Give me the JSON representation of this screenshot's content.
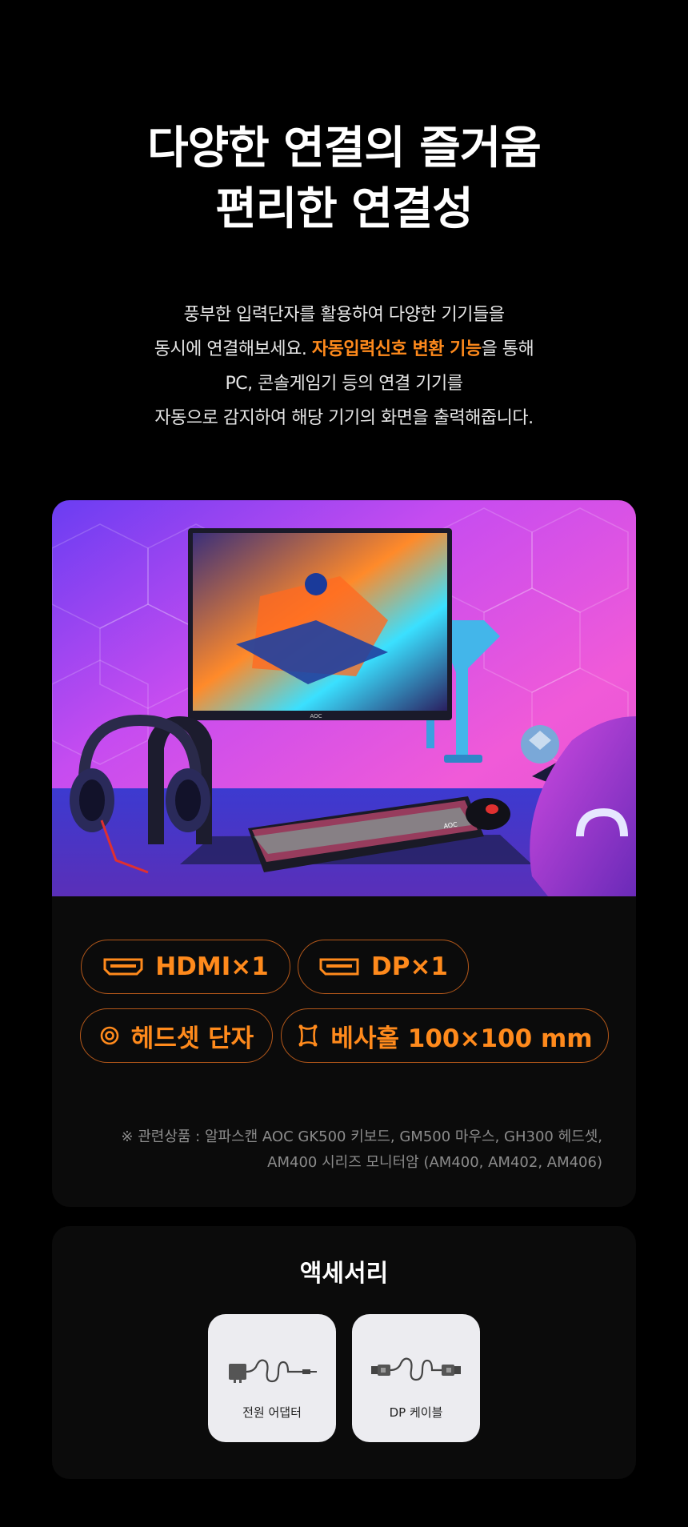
{
  "headline": {
    "line1": "다양한 연결의 즐거움",
    "line2": "편리한 연결성"
  },
  "description": {
    "line1": "풍부한 입력단자를 활용하여 다양한 기기들을",
    "line2_pre": "동시에 연결해보세요. ",
    "line2_highlight": "자동입력신호 변환 기능",
    "line2_post": "을 통해",
    "line3": "PC, 콘솔게임기 등의 연결 기기를",
    "line4": "자동으로 감지하여 해당 기기의 화면을 출력해줍니다."
  },
  "colors": {
    "accent": "#ff8a1c",
    "badge_border": "#b4581a",
    "card_bg": "#0b0b0b",
    "page_bg": "#000000"
  },
  "ports": {
    "hdmi": {
      "label": "HDMI×1",
      "icon": "hdmi-port-icon"
    },
    "dp": {
      "label": "DP×1",
      "icon": "displayport-icon"
    },
    "headset": {
      "label": "헤드셋 단자",
      "icon": "headset-jack-icon"
    },
    "vesa": {
      "label": "베사홀 100×100 mm",
      "icon": "vesa-mount-icon"
    }
  },
  "related_note": {
    "line1": "※ 관련상품 : 알파스캔 AOC GK500 키보드, GM500 마우스, GH300 헤드셋,",
    "line2": "AM400 시리즈 모니터암 (AM400, AM402, AM406)"
  },
  "monitor_logo": "AOC",
  "keyboard_logo": "AOC",
  "accessories": {
    "title": "액세서리",
    "items": [
      {
        "label": "전원 어댑터",
        "icon": "power-adapter-icon"
      },
      {
        "label": "DP 케이블",
        "icon": "dp-cable-icon"
      }
    ]
  }
}
